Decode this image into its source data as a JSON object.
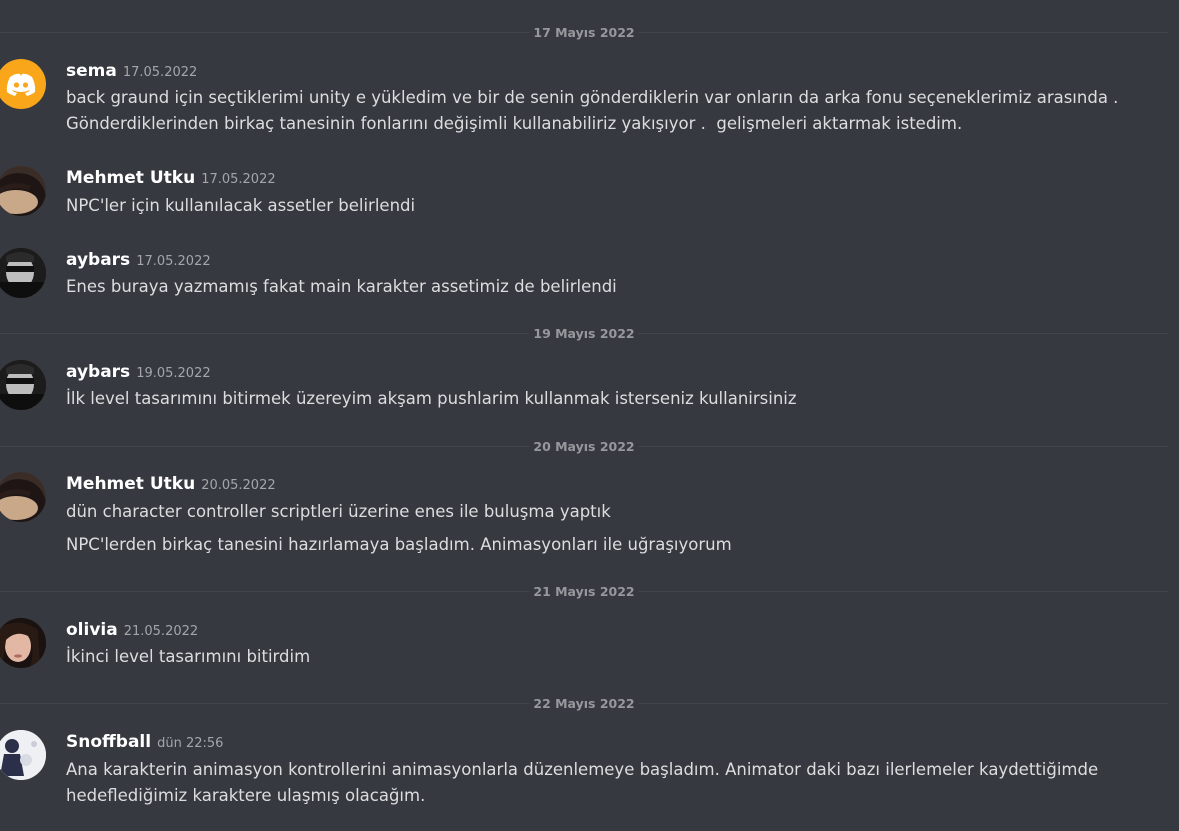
{
  "dividers": [
    "17 Mayıs 2022",
    "19 Mayıs 2022",
    "20 Mayıs 2022",
    "21 Mayıs 2022",
    "22 Mayıs 2022"
  ],
  "messages": [
    {
      "author": "sema",
      "timestamp": "17.05.2022",
      "lines": [
        "back graund için seçtiklerimi unity e yükledim ve bir de senin gönderdiklerin var onların da arka fonu seçeneklerimiz arasında .",
        "Gönderdiklerinden birkaç tanesinin fonlarını değişimli kullanabiliriz yakışıyor .  gelişmeleri aktarmak istedim."
      ]
    },
    {
      "author": "Mehmet Utku",
      "timestamp": "17.05.2022",
      "lines": [
        "NPC'ler için kullanılacak assetler belirlendi"
      ]
    },
    {
      "author": "aybars",
      "timestamp": "17.05.2022",
      "lines": [
        "Enes buraya yazmamış fakat main karakter assetimiz de belirlendi"
      ]
    },
    {
      "author": "aybars",
      "timestamp": "19.05.2022",
      "lines": [
        "İlk level tasarımını bitirmek üzereyim akşam pushlarim kullanmak isterseniz kullanirsiniz"
      ]
    },
    {
      "author": "Mehmet Utku",
      "timestamp": "20.05.2022",
      "lines": [
        "dün character controller scriptleri üzerine enes ile buluşma yaptık"
      ]
    },
    {
      "followup": "NPC'lerden birkaç tanesini hazırlamaya başladım. Animasyonları ile uğraşıyorum"
    },
    {
      "author": "olivia",
      "timestamp": "21.05.2022",
      "lines": [
        "İkinci level tasarımını bitirdim"
      ]
    },
    {
      "author": "Snoffball",
      "timestamp": "dün 22:56",
      "lines": [
        "Ana karakterin animasyon kontrollerini animasyonlarla düzenlemeye başladım. Animator daki bazı ilerlemeler kaydettiğimde",
        "hedeflediğimiz karaktere ulaşmış olacağım."
      ]
    }
  ]
}
